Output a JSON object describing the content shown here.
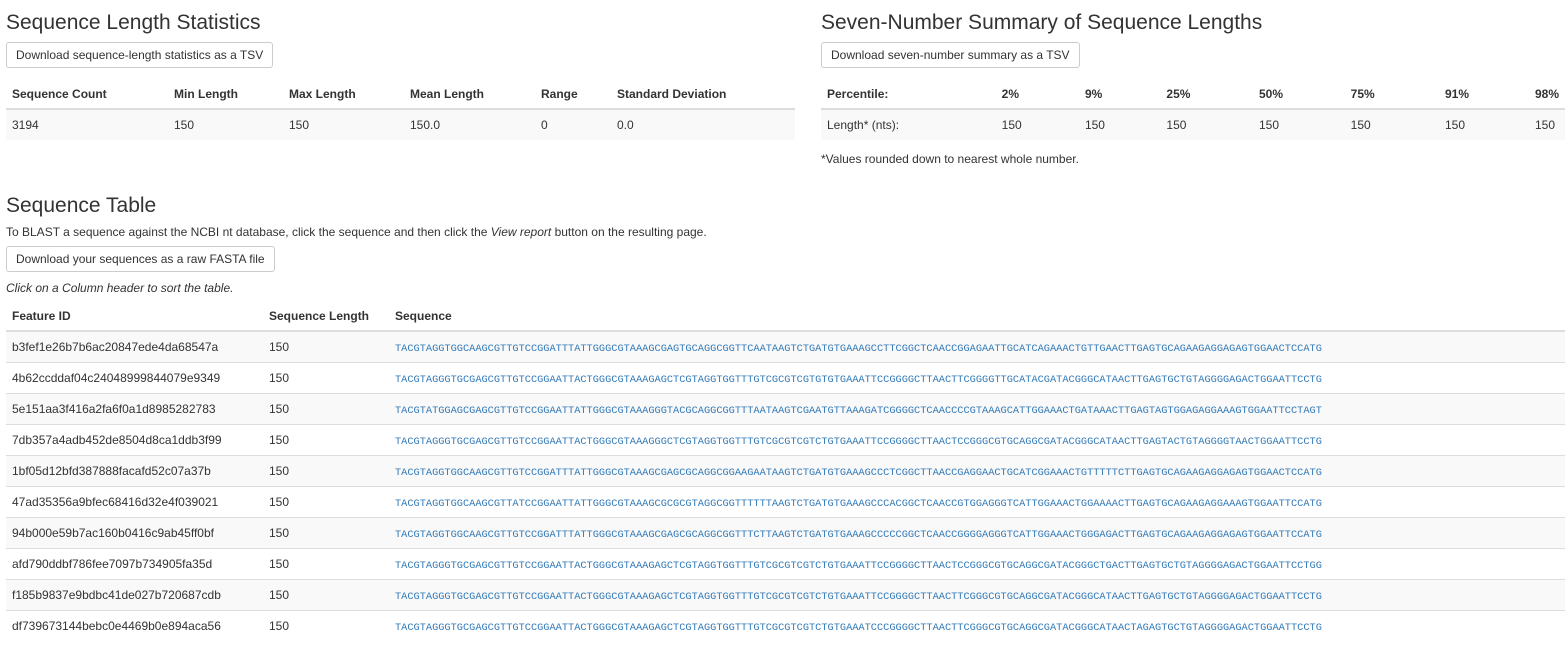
{
  "stats": {
    "title": "Sequence Length Statistics",
    "download_label": "Download sequence-length statistics as a TSV",
    "headers": [
      "Sequence Count",
      "Min Length",
      "Max Length",
      "Mean Length",
      "Range",
      "Standard Deviation"
    ],
    "values": [
      "3194",
      "150",
      "150",
      "150.0",
      "0",
      "0.0"
    ]
  },
  "summary": {
    "title": "Seven-Number Summary of Sequence Lengths",
    "download_label": "Download seven-number summary as a TSV",
    "headers": [
      "Percentile:",
      "2%",
      "9%",
      "25%",
      "50%",
      "75%",
      "91%",
      "98%"
    ],
    "values": [
      "Length* (nts):",
      "150",
      "150",
      "150",
      "150",
      "150",
      "150",
      "150"
    ],
    "note": "*Values rounded down to nearest whole number."
  },
  "sequences": {
    "title": "Sequence Table",
    "blast_note_prefix": "To BLAST a sequence against the NCBI nt database, click the sequence and then click the ",
    "blast_note_em": "View report",
    "blast_note_suffix": " button on the resulting page.",
    "download_label": "Download your sequences as a raw FASTA file",
    "sort_note": "Click on a Column header to sort the table.",
    "headers": [
      "Feature ID",
      "Sequence Length",
      "Sequence"
    ],
    "rows": [
      {
        "id": "b3fef1e26b7b6ac20847ede4da68547a",
        "length": "150",
        "sequence": "TACGTAGGTGGCAAGCGTTGTCCGGATTTATTGGGCGTAAAGCGAGTGCAGGCGGTTCAATAAGTCTGATGTGAAAGCCTTCGGCTCAACCGGAGAATTGCATCAGAAACTGTTGAACTTGAGTGCAGAAGAGGAGAGTGGAACTCCATG"
      },
      {
        "id": "4b62ccddaf04c24048999844079e9349",
        "length": "150",
        "sequence": "TACGTAGGGTGCGAGCGTTGTCCGGAATTACTGGGCGTAAAGAGCTCGTAGGTGGTTTGTCGCGTCGTGTGTGAAATTCCGGGGCTTAACTTCGGGGTTGCATACGATACGGGCATAACTTGAGTGCTGTAGGGGAGACTGGAATTCCTG"
      },
      {
        "id": "5e151aa3f416a2fa6f0a1d8985282783",
        "length": "150",
        "sequence": "TACGTATGGAGCGAGCGTTGTCCGGAATTATTGGGCGTAAAGGGTACGCAGGCGGTTTAATAAGTCGAATGTTAAAGATCGGGGCTCAACCCCGTAAAGCATTGGAAACTGATAAACTTGAGTAGTGGAGAGGAAAGTGGAATTCCTAGT"
      },
      {
        "id": "7db357a4adb452de8504d8ca1ddb3f99",
        "length": "150",
        "sequence": "TACGTAGGGTGCGAGCGTTGTCCGGAATTACTGGGCGTAAAGGGCTCGTAGGTGGTTTGTCGCGTCGTCTGTGAAATTCCGGGGCTTAACTCCGGGCGTGCAGGCGATACGGGCATAACTTGAGTACTGTAGGGGTAACTGGAATTCCTG"
      },
      {
        "id": "1bf05d12bfd387888facafd52c07a37b",
        "length": "150",
        "sequence": "TACGTAGGTGGCAAGCGTTGTCCGGATTTATTGGGCGTAAAGCGAGCGCAGGCGGAAGAATAAGTCTGATGTGAAAGCCCTCGGCTTAACCGAGGAACTGCATCGGAAACTGTTTTTCTTGAGTGCAGAAGAGGAGAGTGGAACTCCATG"
      },
      {
        "id": "47ad35356a9bfec68416d32e4f039021",
        "length": "150",
        "sequence": "TACGTAGGTGGCAAGCGTTATCCGGAATTATTGGGCGTAAAGCGCGCGTAGGCGGTTTTTTAAGTCTGATGTGAAAGCCCACGGCTCAACCGTGGAGGGTCATTGGAAACTGGAAAACTTGAGTGCAGAAGAGGAAAGTGGAATTCCATG"
      },
      {
        "id": "94b000e59b7ac160b0416c9ab45ff0bf",
        "length": "150",
        "sequence": "TACGTAGGTGGCAAGCGTTGTCCGGATTTATTGGGCGTAAAGCGAGCGCAGGCGGTTTCTTAAGTCTGATGTGAAAGCCCCCGGCTCAACCGGGGAGGGTCATTGGAAACTGGGAGACTTGAGTGCAGAAGAGGAGAGTGGAATTCCATG"
      },
      {
        "id": "afd790ddbf786fee7097b734905fa35d",
        "length": "150",
        "sequence": "TACGTAGGGTGCGAGCGTTGTCCGGAATTACTGGGCGTAAAGAGCTCGTAGGTGGTTTGTCGCGTCGTCTGTGAAATTCCGGGGCTTAACTCCGGGCGTGCAGGCGATACGGGCTGACTTGAGTGCTGTAGGGGAGACTGGAATTCCTGG"
      },
      {
        "id": "f185b9837e9bdbc41de027b720687cdb",
        "length": "150",
        "sequence": "TACGTAGGGTGCGAGCGTTGTCCGGAATTACTGGGCGTAAAGAGCTCGTAGGTGGTTTGTCGCGTCGTCTGTGAAATTCCGGGGCTTAACTTCGGGCGTGCAGGCGATACGGGCATAACTTGAGTGCTGTAGGGGAGACTGGAATTCCTG"
      },
      {
        "id": "df739673144bebc0e4469b0e894aca56",
        "length": "150",
        "sequence": "TACGTAGGGTGCGAGCGTTGTCCGGAATTACTGGGCGTAAAGAGCTCGTAGGTGGTTTGTCGCGTCGTCTGTGAAATCCCGGGGCTTAACTTCGGGCGTGCAGGCGATACGGGCATAACTAGAGTGCTGTAGGGGAGACTGGAATTCCTG"
      }
    ]
  }
}
